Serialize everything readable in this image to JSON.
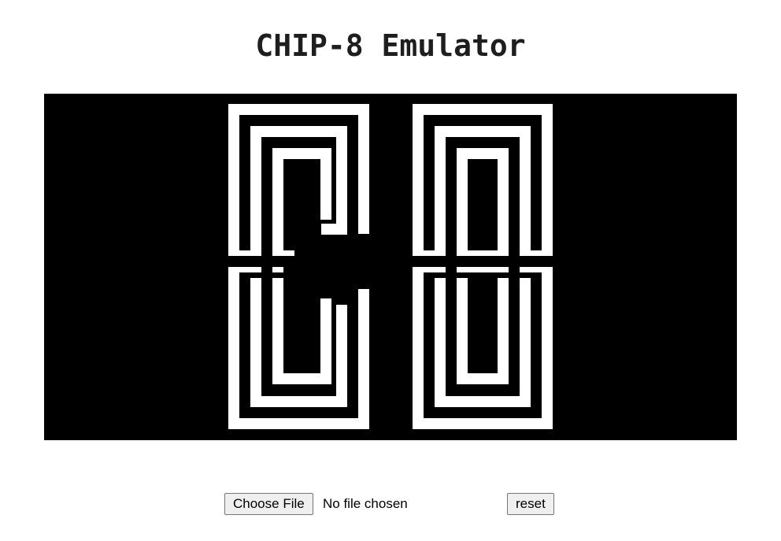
{
  "page": {
    "title": "CHIP-8 Emulator"
  },
  "display": {
    "background_color": "#000000",
    "pixel_color": "#ffffff",
    "content": "CHIP-8 boot logo (stylized maze-like \"C8\")"
  },
  "controls": {
    "file_button_label": "Choose File",
    "file_status": "No file chosen",
    "reset_label": "reset"
  }
}
